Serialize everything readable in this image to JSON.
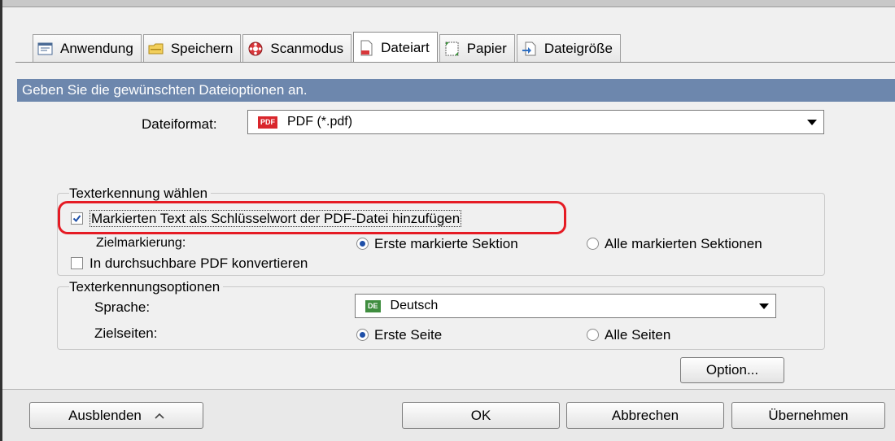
{
  "tabs": [
    {
      "label": "Anwendung",
      "icon": "application-icon"
    },
    {
      "label": "Speichern",
      "icon": "folder-icon"
    },
    {
      "label": "Scanmodus",
      "icon": "scanmode-icon"
    },
    {
      "label": "Dateiart",
      "icon": "filetype-icon",
      "active": true
    },
    {
      "label": "Papier",
      "icon": "paper-icon"
    },
    {
      "label": "Dateigröße",
      "icon": "filesize-icon"
    }
  ],
  "header": {
    "text": "Geben Sie die gewünschten Dateioptionen an."
  },
  "file_format": {
    "label": "Dateiformat:",
    "badge": "PDF",
    "value": "PDF (*.pdf)"
  },
  "ocr_group": {
    "title": "Texterkennung wählen",
    "keyword_checkbox": {
      "label": "Markierten Text als Schlüsselwort der PDF-Datei hinzufügen",
      "checked": true
    },
    "target_marking": {
      "label": "Zielmarkierung:",
      "option1": "Erste markierte Sektion",
      "option2": "Alle markierten Sektionen",
      "selected": "option1"
    },
    "searchable_checkbox": {
      "label": "In durchsuchbare PDF konvertieren",
      "checked": false
    }
  },
  "ocr_options": {
    "title": "Texterkennungsoptionen",
    "language_label": "Sprache:",
    "language_badge": "DE",
    "language_value": "Deutsch",
    "target_pages_label": "Zielseiten:",
    "pages_option1": "Erste Seite",
    "pages_option2": "Alle Seiten",
    "pages_selected": "option1"
  },
  "buttons": {
    "option": "Option...",
    "hide": "Ausblenden",
    "ok": "OK",
    "cancel": "Abbrechen",
    "apply": "Übernehmen"
  },
  "colors": {
    "header_bg": "#6d87ad",
    "highlight": "#e51b24",
    "pdf_badge": "#d9262c",
    "de_badge": "#3f8d3f"
  }
}
